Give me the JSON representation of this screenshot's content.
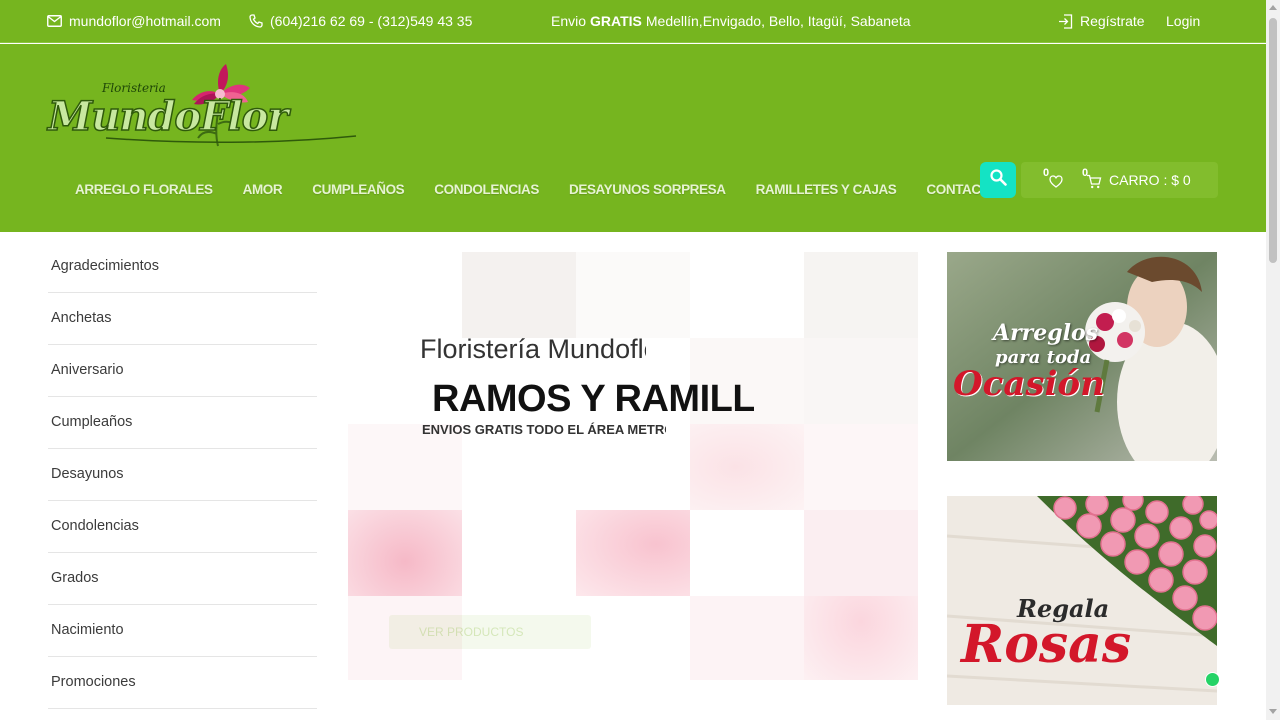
{
  "topbar": {
    "email": "mundoflor@hotmail.com",
    "phones": "(604)216 62 69 - (312)549 43 35",
    "shipping_prefix": "Envio",
    "shipping_bold": "GRATIS",
    "shipping_places": "Medellín,Envigado, Bello, Itagüí, Sabaneta",
    "register_label": "Regístrate",
    "login_label": "Login"
  },
  "logo": {
    "small_text": "Floristeria",
    "main_text": "MundoFlor"
  },
  "nav": {
    "items": [
      {
        "label": "ARREGLO FLORALES"
      },
      {
        "label": "AMOR"
      },
      {
        "label": "CUMPLEAÑOS"
      },
      {
        "label": "CONDOLENCIAS"
      },
      {
        "label": "DESAYUNOS SORPRESA"
      },
      {
        "label": "RAMILLETES Y CAJAS"
      },
      {
        "label": "CONTACTO"
      }
    ]
  },
  "cart": {
    "wishlist_count": "0",
    "cart_count": "0",
    "label": "CARRO : $ 0"
  },
  "sidebar": {
    "categories": [
      {
        "label": "Agradecimientos"
      },
      {
        "label": "Anchetas"
      },
      {
        "label": "Aniversario"
      },
      {
        "label": "Cumpleaños"
      },
      {
        "label": "Desayunos"
      },
      {
        "label": "Condolencias"
      },
      {
        "label": "Grados"
      },
      {
        "label": "Nacimiento"
      },
      {
        "label": "Promociones"
      }
    ]
  },
  "slider": {
    "pretitle": "Floristería Mundoflor",
    "title": "RAMOS Y RAMILLETES",
    "subtitle": "ENVIOS GRATIS TODO EL ÁREA METROPOLITANA",
    "button_label": "VER PRODUCTOS"
  },
  "banners": {
    "banner1": {
      "line1": "Arreglos",
      "line2": "para toda",
      "line3": "Ocasión"
    },
    "banner2": {
      "line1": "Regala",
      "line2": "Rosas"
    }
  },
  "colors": {
    "brand_green": "#76b51f",
    "search_accent": "#14e3c4",
    "banner_red": "#d3172a"
  }
}
